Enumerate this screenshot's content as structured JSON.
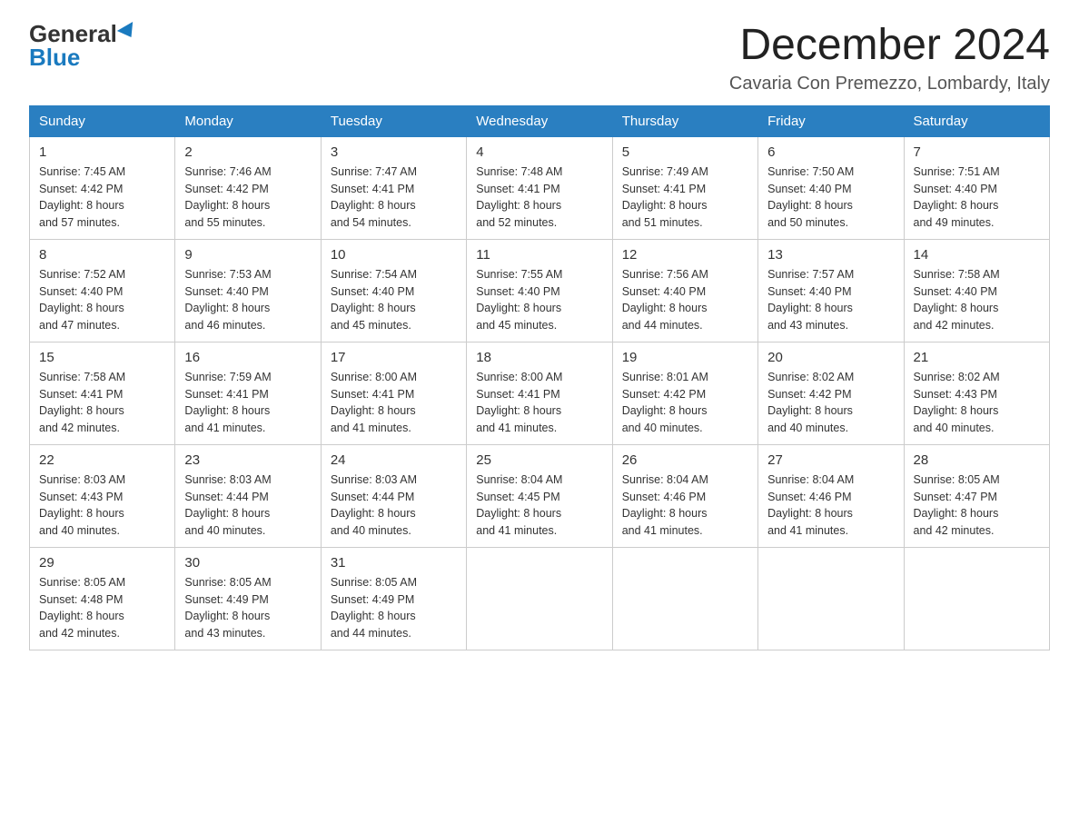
{
  "header": {
    "logo_general": "General",
    "logo_blue": "Blue",
    "month_title": "December 2024",
    "location": "Cavaria Con Premezzo, Lombardy, Italy"
  },
  "days_of_week": [
    "Sunday",
    "Monday",
    "Tuesday",
    "Wednesday",
    "Thursday",
    "Friday",
    "Saturday"
  ],
  "weeks": [
    [
      {
        "day": "1",
        "sunrise": "7:45 AM",
        "sunset": "4:42 PM",
        "daylight": "8 hours and 57 minutes."
      },
      {
        "day": "2",
        "sunrise": "7:46 AM",
        "sunset": "4:42 PM",
        "daylight": "8 hours and 55 minutes."
      },
      {
        "day": "3",
        "sunrise": "7:47 AM",
        "sunset": "4:41 PM",
        "daylight": "8 hours and 54 minutes."
      },
      {
        "day": "4",
        "sunrise": "7:48 AM",
        "sunset": "4:41 PM",
        "daylight": "8 hours and 52 minutes."
      },
      {
        "day": "5",
        "sunrise": "7:49 AM",
        "sunset": "4:41 PM",
        "daylight": "8 hours and 51 minutes."
      },
      {
        "day": "6",
        "sunrise": "7:50 AM",
        "sunset": "4:40 PM",
        "daylight": "8 hours and 50 minutes."
      },
      {
        "day": "7",
        "sunrise": "7:51 AM",
        "sunset": "4:40 PM",
        "daylight": "8 hours and 49 minutes."
      }
    ],
    [
      {
        "day": "8",
        "sunrise": "7:52 AM",
        "sunset": "4:40 PM",
        "daylight": "8 hours and 47 minutes."
      },
      {
        "day": "9",
        "sunrise": "7:53 AM",
        "sunset": "4:40 PM",
        "daylight": "8 hours and 46 minutes."
      },
      {
        "day": "10",
        "sunrise": "7:54 AM",
        "sunset": "4:40 PM",
        "daylight": "8 hours and 45 minutes."
      },
      {
        "day": "11",
        "sunrise": "7:55 AM",
        "sunset": "4:40 PM",
        "daylight": "8 hours and 45 minutes."
      },
      {
        "day": "12",
        "sunrise": "7:56 AM",
        "sunset": "4:40 PM",
        "daylight": "8 hours and 44 minutes."
      },
      {
        "day": "13",
        "sunrise": "7:57 AM",
        "sunset": "4:40 PM",
        "daylight": "8 hours and 43 minutes."
      },
      {
        "day": "14",
        "sunrise": "7:58 AM",
        "sunset": "4:40 PM",
        "daylight": "8 hours and 42 minutes."
      }
    ],
    [
      {
        "day": "15",
        "sunrise": "7:58 AM",
        "sunset": "4:41 PM",
        "daylight": "8 hours and 42 minutes."
      },
      {
        "day": "16",
        "sunrise": "7:59 AM",
        "sunset": "4:41 PM",
        "daylight": "8 hours and 41 minutes."
      },
      {
        "day": "17",
        "sunrise": "8:00 AM",
        "sunset": "4:41 PM",
        "daylight": "8 hours and 41 minutes."
      },
      {
        "day": "18",
        "sunrise": "8:00 AM",
        "sunset": "4:41 PM",
        "daylight": "8 hours and 41 minutes."
      },
      {
        "day": "19",
        "sunrise": "8:01 AM",
        "sunset": "4:42 PM",
        "daylight": "8 hours and 40 minutes."
      },
      {
        "day": "20",
        "sunrise": "8:02 AM",
        "sunset": "4:42 PM",
        "daylight": "8 hours and 40 minutes."
      },
      {
        "day": "21",
        "sunrise": "8:02 AM",
        "sunset": "4:43 PM",
        "daylight": "8 hours and 40 minutes."
      }
    ],
    [
      {
        "day": "22",
        "sunrise": "8:03 AM",
        "sunset": "4:43 PM",
        "daylight": "8 hours and 40 minutes."
      },
      {
        "day": "23",
        "sunrise": "8:03 AM",
        "sunset": "4:44 PM",
        "daylight": "8 hours and 40 minutes."
      },
      {
        "day": "24",
        "sunrise": "8:03 AM",
        "sunset": "4:44 PM",
        "daylight": "8 hours and 40 minutes."
      },
      {
        "day": "25",
        "sunrise": "8:04 AM",
        "sunset": "4:45 PM",
        "daylight": "8 hours and 41 minutes."
      },
      {
        "day": "26",
        "sunrise": "8:04 AM",
        "sunset": "4:46 PM",
        "daylight": "8 hours and 41 minutes."
      },
      {
        "day": "27",
        "sunrise": "8:04 AM",
        "sunset": "4:46 PM",
        "daylight": "8 hours and 41 minutes."
      },
      {
        "day": "28",
        "sunrise": "8:05 AM",
        "sunset": "4:47 PM",
        "daylight": "8 hours and 42 minutes."
      }
    ],
    [
      {
        "day": "29",
        "sunrise": "8:05 AM",
        "sunset": "4:48 PM",
        "daylight": "8 hours and 42 minutes."
      },
      {
        "day": "30",
        "sunrise": "8:05 AM",
        "sunset": "4:49 PM",
        "daylight": "8 hours and 43 minutes."
      },
      {
        "day": "31",
        "sunrise": "8:05 AM",
        "sunset": "4:49 PM",
        "daylight": "8 hours and 44 minutes."
      },
      null,
      null,
      null,
      null
    ]
  ],
  "labels": {
    "sunrise": "Sunrise:",
    "sunset": "Sunset:",
    "daylight": "Daylight:"
  }
}
